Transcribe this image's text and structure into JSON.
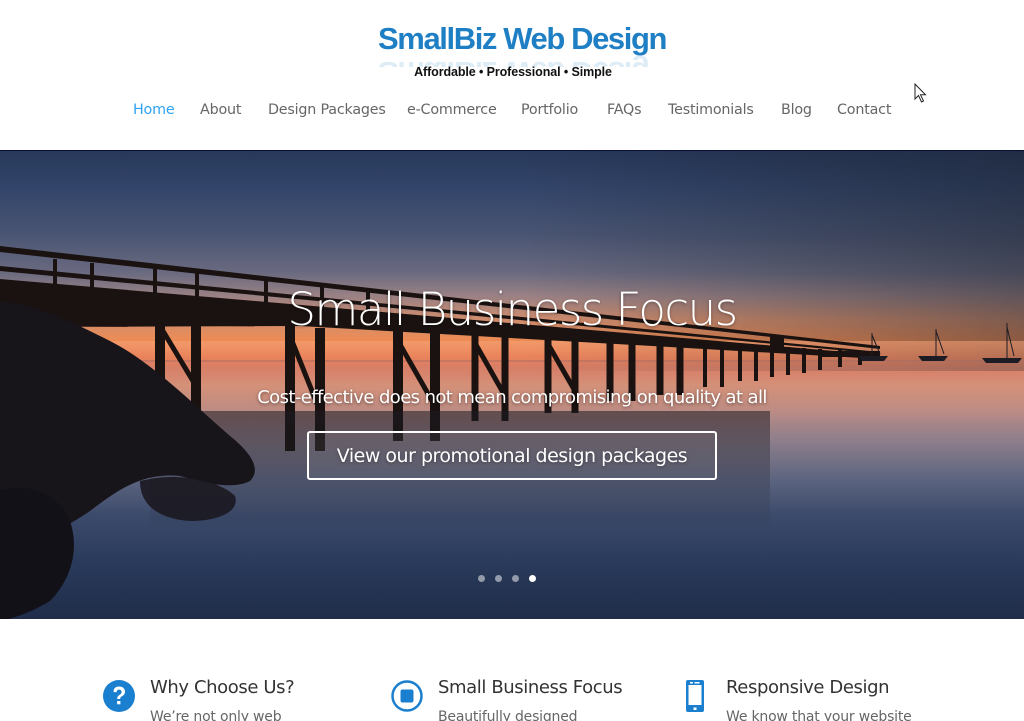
{
  "logo": {
    "title": "SmallBiz Web Design",
    "tagline": "Affordable • Professional • Simple"
  },
  "nav": {
    "items": [
      {
        "label": "Home",
        "active": true
      },
      {
        "label": "About"
      },
      {
        "label": "Design Packages"
      },
      {
        "label": "e-Commerce"
      },
      {
        "label": "Portfolio"
      },
      {
        "label": "FAQs"
      },
      {
        "label": "Testimonials"
      },
      {
        "label": "Blog"
      },
      {
        "label": "Contact"
      }
    ]
  },
  "hero": {
    "title": "Small Business Focus",
    "subtitle": "Cost-effective does not mean compromising on quality at all",
    "button_label": "View our promotional design packages",
    "slides_total": 4,
    "active_slide": 4
  },
  "features": [
    {
      "icon": "question-circle-icon",
      "title": "Why Choose Us?",
      "text": "We’re not only web"
    },
    {
      "icon": "stop-circle-icon",
      "title": "Small Business Focus",
      "text": "Beautifully designed"
    },
    {
      "icon": "mobile-phone-icon",
      "title": "Responsive Design",
      "text": "We know that your website"
    }
  ],
  "colors": {
    "accent": "#2ea3f2",
    "logo_blue": "#1f7fc4",
    "icon_blue": "#1a7fcf",
    "nav_text": "#666666"
  }
}
